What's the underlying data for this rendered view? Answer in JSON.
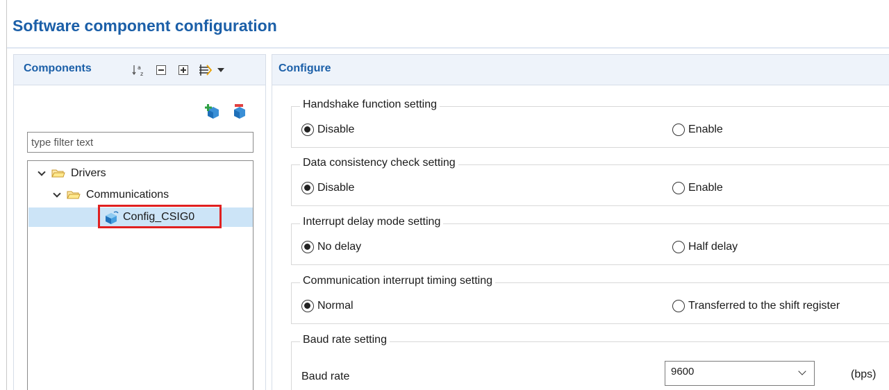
{
  "page": {
    "title": "Software component configuration"
  },
  "components": {
    "title": "Components",
    "toolbar": {
      "sort_icon": "sort-az-icon",
      "collapse_icon": "collapse-all-icon",
      "expand_icon": "expand-all-icon",
      "link_icon": "link-with-editor-icon",
      "menu_icon": "dropdown-arrow-icon"
    },
    "add_icon": "add-component-icon",
    "remove_icon": "remove-component-icon",
    "filter": {
      "placeholder": "type filter text",
      "value": ""
    },
    "tree": [
      {
        "label": "Drivers",
        "level": 0,
        "expanded": true,
        "icon": "folder-open-icon"
      },
      {
        "label": "Communications",
        "level": 1,
        "expanded": true,
        "icon": "folder-open-icon"
      },
      {
        "label": "Config_CSIG0",
        "level": 2,
        "selected": true,
        "icon": "component-cube-icon"
      }
    ]
  },
  "configure": {
    "title": "Configure",
    "groups": [
      {
        "legend": "Handshake function setting",
        "options": [
          {
            "label": "Disable",
            "checked": true
          },
          {
            "label": "Enable",
            "checked": false
          }
        ]
      },
      {
        "legend": "Data consistency check setting",
        "options": [
          {
            "label": "Disable",
            "checked": true
          },
          {
            "label": "Enable",
            "checked": false
          }
        ]
      },
      {
        "legend": "Interrupt delay mode setting",
        "options": [
          {
            "label": "No delay",
            "checked": true
          },
          {
            "label": "Half delay",
            "checked": false
          }
        ]
      },
      {
        "legend": "Communication interrupt timing setting",
        "options": [
          {
            "label": "Normal",
            "checked": true
          },
          {
            "label": "Transferred to the shift register",
            "checked": false
          }
        ]
      }
    ],
    "baud": {
      "legend": "Baud rate setting",
      "label": "Baud rate",
      "value": "9600",
      "unit": "(bps)"
    }
  },
  "colors": {
    "title": "#1b5fa8",
    "header_bg": "#eef3fa",
    "selection": "#cce4f7",
    "highlight_box": "#e02020"
  }
}
